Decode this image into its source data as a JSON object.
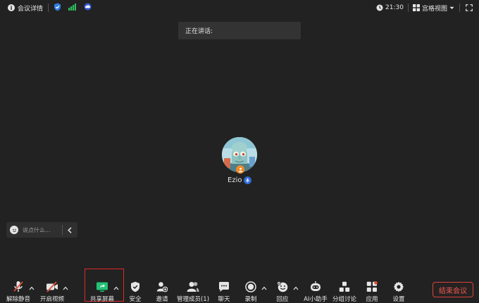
{
  "topbar": {
    "meeting_info": "会议详情",
    "time": "21:30",
    "view_mode": "宫格视图"
  },
  "speaking_label": "正在讲话:",
  "participant": {
    "name": "Ezio"
  },
  "chat": {
    "placeholder": "说点什么..."
  },
  "toolbar": {
    "unmute": "解除静音",
    "start_video": "开启视频",
    "share_screen": "共享屏幕",
    "security": "安全",
    "invite": "邀请",
    "manage_members": "管理成员(1)",
    "chat": "聊天",
    "record": "录制",
    "reactions": "回应",
    "ai_assistant": "AI小助手",
    "breakout": "分组讨论",
    "apps": "应用",
    "settings": "设置",
    "end_meeting": "结束会议"
  },
  "colors": {
    "background": "#222222",
    "share_green": "#23c274",
    "end_red": "#ef5a4f",
    "muted_red": "#e24b3b",
    "accent_blue": "#2e6ad6",
    "host_orange": "#f08a24"
  }
}
